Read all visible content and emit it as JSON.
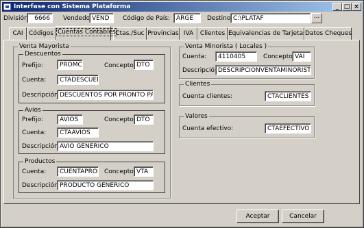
{
  "window": {
    "title": "Interfase con Sistema Plataforma"
  },
  "header": {
    "division_label": "División:",
    "division_value": "6666",
    "vendedor_label": "Vendedor",
    "vendedor_value": "VEND",
    "pais_label": "Código de País:",
    "pais_value": "ARGE",
    "destino_label": "Destino:",
    "destino_value": "C:\\PLATAF",
    "browse_label": "..."
  },
  "tabs": [
    {
      "label": "CAI"
    },
    {
      "label": "Códigos"
    },
    {
      "label": "Cuentas Contables"
    },
    {
      "label": "Ctas./Suc"
    },
    {
      "label": "Provincias"
    },
    {
      "label": "IVA"
    },
    {
      "label": "Clientes"
    },
    {
      "label": "Equivalencias de Tarjetas"
    },
    {
      "label": "Datos Cheques"
    }
  ],
  "mayorista": {
    "title": "Venta Mayorista",
    "descuentos": {
      "title": "Descuentos",
      "prefijo_label": "Prefijo:",
      "prefijo_value": "PROMC",
      "concepto_label": "Concepto:",
      "concepto_value": "DTO",
      "cuenta_label": "Cuenta:",
      "cuenta_value": "CTADESCUENT",
      "descripcion_label": "Descripción:",
      "descripcion_value": "DESCUENTOS POR PRONTO PAGO"
    },
    "avios": {
      "title": "Avios",
      "prefijo_label": "Prefijo:",
      "prefijo_value": "AVIOS",
      "concepto_label": "Concepto:",
      "concepto_value": "DTO",
      "cuenta_label": "Cuenta:",
      "cuenta_value": "CTAAVIOS",
      "descripcion_label": "Descripción:",
      "descripcion_value": "AVIO GENERICO"
    },
    "productos": {
      "title": "Productos",
      "cuenta_label": "Cuenta:",
      "cuenta_value": "CUENTAPRODU",
      "concepto_label": "Concepto:",
      "concepto_value": "VTA",
      "descripcion_label": "Descripción:",
      "descripcion_value": "PRODUCTO GENERICO"
    }
  },
  "minorista": {
    "title": "Venta Minorista ( Locales )",
    "cuenta_label": "Cuenta:",
    "cuenta_value": "4110405",
    "concepto_label": "Concepto:",
    "concepto_value": "VAI",
    "descripcion_label": "Descripción:",
    "descripcion_value": "DESCRIPCIONVENTAMINORISTA"
  },
  "clientes": {
    "title": "Clientes",
    "cuenta_label": "Cuenta clientes:",
    "cuenta_value": "CTACLIENTES"
  },
  "valores": {
    "title": "Valores",
    "cuenta_label": "Cuenta efectivo:",
    "cuenta_value": "CTAEFECTIVO"
  },
  "footer": {
    "accept_label": "Aceptar",
    "cancel_label": "Cancelar"
  }
}
